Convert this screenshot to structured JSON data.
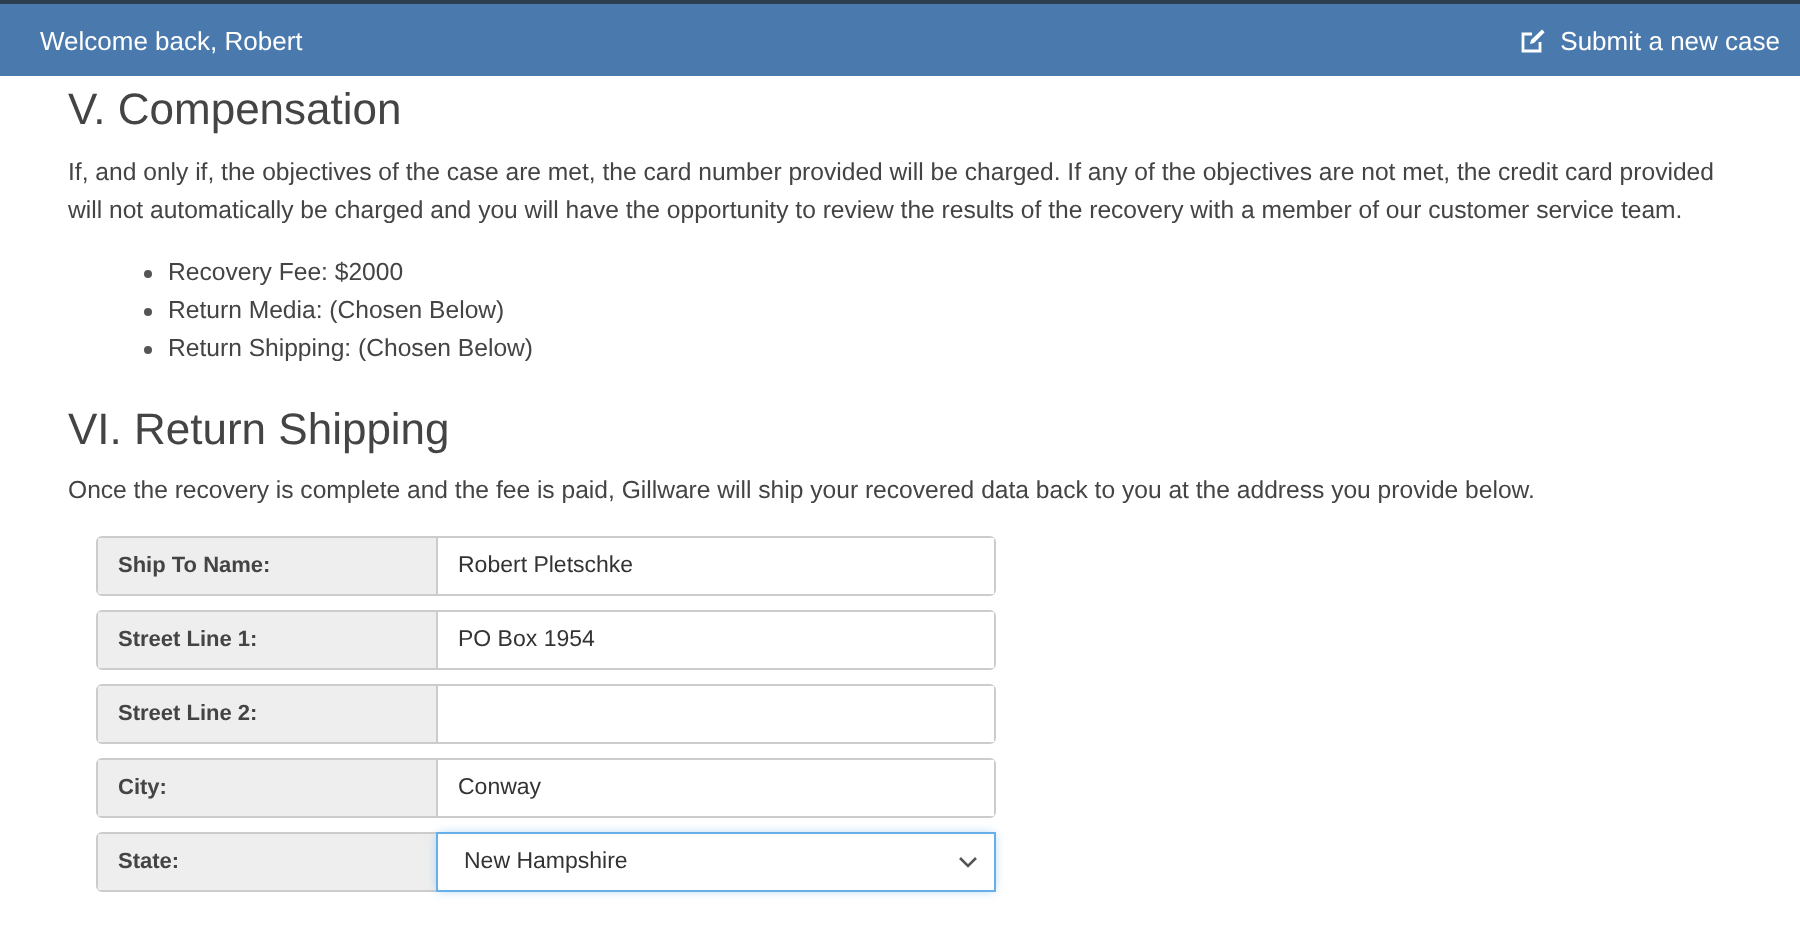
{
  "header": {
    "greeting": "Welcome back, Robert",
    "action": "Submit a new case"
  },
  "compensation": {
    "heading": "V. Compensation",
    "text": "If, and only if, the objectives of the case are met, the card number provided will be charged. If any of the objectives are not met, the credit card provided will not automatically be charged and you will have the opportunity to review the results of the recovery with a member of our customer service team.",
    "items": [
      "Recovery Fee: $2000",
      "Return Media: (Chosen Below)",
      "Return Shipping: (Chosen Below)"
    ]
  },
  "shipping": {
    "heading": "VI. Return Shipping",
    "text": "Once the recovery is complete and the fee is paid, Gillware will ship your recovered data back to you at the address you provide below.",
    "fields": [
      {
        "label": "Ship To Name:",
        "kind": "text",
        "value": "Robert Pletschke",
        "focused": false
      },
      {
        "label": "Street Line 1:",
        "kind": "text",
        "value": "PO Box 1954",
        "focused": false
      },
      {
        "label": "Street Line 2:",
        "kind": "text",
        "focused": false
      },
      {
        "label": "City:",
        "kind": "text",
        "value": "Conway",
        "focused": false
      },
      {
        "label": "State:",
        "kind": "select",
        "value": "New Hampshire",
        "focused": true
      }
    ]
  }
}
